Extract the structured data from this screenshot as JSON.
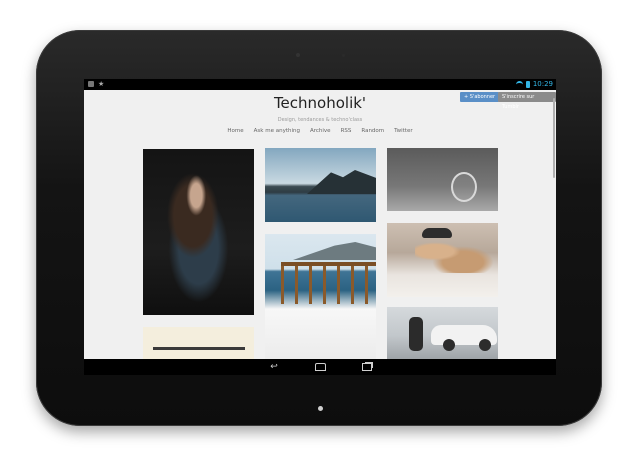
{
  "status_bar": {
    "time": "10:29"
  },
  "header": {
    "follow_label": "+ S'abonner",
    "signup_label": "S'inscrire sur Tumblr"
  },
  "blog": {
    "title": "Technoholik'",
    "subtitle": "Design, tendances & techno'class"
  },
  "nav": {
    "items": [
      "Home",
      "Ask me anything",
      "Archive",
      "RSS",
      "Random",
      "Twitter"
    ]
  },
  "colors": {
    "accent": "#33b5e5",
    "follow_button": "#5a8fc7",
    "page_background": "#f0f0f0"
  },
  "icons": {
    "back": "back-arrow-icon",
    "home": "home-icon",
    "recent": "recent-apps-icon"
  }
}
